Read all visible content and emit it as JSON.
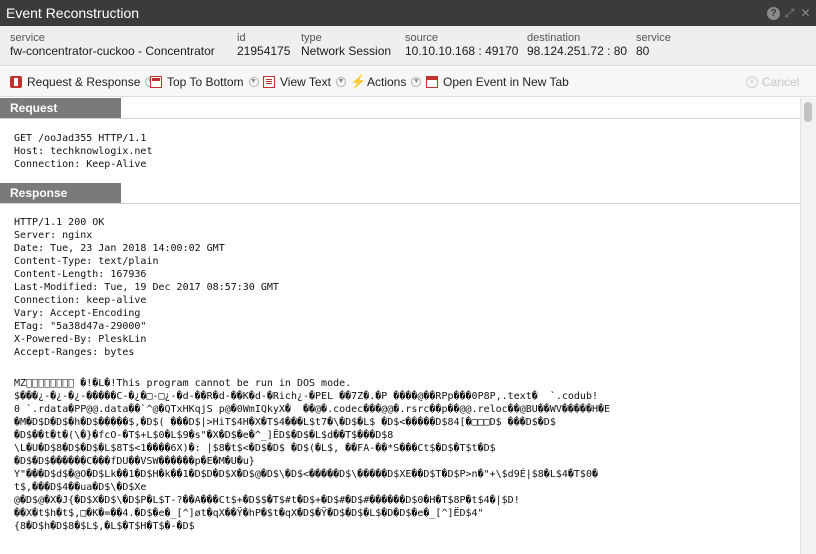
{
  "window": {
    "title": "Event Reconstruction"
  },
  "meta": {
    "service": {
      "label": "service",
      "value": "fw-concentrator-cuckoo - Concentrator"
    },
    "id": {
      "label": "id",
      "value": "21954175"
    },
    "type": {
      "label": "type",
      "value": "Network Session"
    },
    "source": {
      "label": "source",
      "value": "10.10.10.168 : 49170"
    },
    "destination": {
      "label": "destination",
      "value": "98.124.251.72 : 80"
    },
    "service_port": {
      "label": "service",
      "value": "80"
    }
  },
  "toolbar": {
    "request_response": "Request & Response",
    "top_to_bottom": "Top To Bottom",
    "view_text": "View Text",
    "actions": "Actions",
    "open_event": "Open Event in New Tab",
    "cancel": "Cancel"
  },
  "request": {
    "header": "Request",
    "text": "GET /ooJad355 HTTP/1.1\nHost: techknowlogix.net\nConnection: Keep-Alive"
  },
  "response": {
    "header": "Response",
    "text": "HTTP/1.1 200 OK\nServer: nginx\nDate: Tue, 23 Jan 2018 14:00:02 GMT\nContent-Type: text/plain\nContent-Length: 167936\nLast-Modified: Tue, 19 Dec 2017 08:57:30 GMT\nConnection: keep-alive\nVary: Accept-Encoding\nETag: \"5a38d47a-29000\"\nX-Powered-By: PleskLin\nAccept-Ranges: bytes",
    "body": "MZ\u0000\u0000\u0000\u0000\u0000\u0000\u0000\u0000 �!�L�!This program cannot be run in DOS mode.\n$���¿-�¿-�¿-�����C-�¿�□-□¿-�d-��R�d-��K�d-�Rich¿-�PEL ��7Z�.�P ����@��RPp���0P8P,.text�  `.codub!\n0 `.rdata�PP@@.data��`^@�QTxHKqjS p@�0WmIQkyX�  ��@�.codec���@@�.rsrc��p��@@.reloc��@BU��WV�����H�E\n�M�D$D�D$�h�D$�����$,�D$( ���D$|>HiT$4H�X�T$4���L$t7�\\�D$�L$ �D$<�����D$84[�□□□D$ ���D$�D$\n�D$��t�t�(\\�}�fcO-�T$+L$0�L$9�s\"�X�D$�e�^_]ËD$�D$�L$d��T$���D$8\n\\L�U�D$8�D$�D$�L$8T$<1����6X)�: |$8�t$<�D$�D$ �D$(�L$, ��FA-��*S���Ct$�D$�T$t�D$\n�D$�D$������C���fDU��VSW������p�E�M�U�u}\nY\"���D$d$�@O�D$Lk��1�D$H�k��1�D$D�D$X�D$@�D$\\�D$<�����D$\\�����D$XE��D$T�D$P>n�\"+\\$d9É|$8�L$4�T$0�\nt$,���D$4��ua�D$\\�D$Xe\n@�D$@�X�J{�D$X�D$\\�D$P�L$T-?��A���Ct$+�D$$�T$#t�D$+�D$#�D$#������D$0�H�T$8P�t$4�|$D!\n��X�t$h�t$,□�K�=��4.�D$�e�_[^]øt�qX��Ÿ�hP�$t�qX�D$�Ÿ�D$�D$�L$�D�D$�e�_[^]ËD$4\"\n{8�D$h�D$8�$L$,�L$�T$H�T$�-�D$"
  }
}
